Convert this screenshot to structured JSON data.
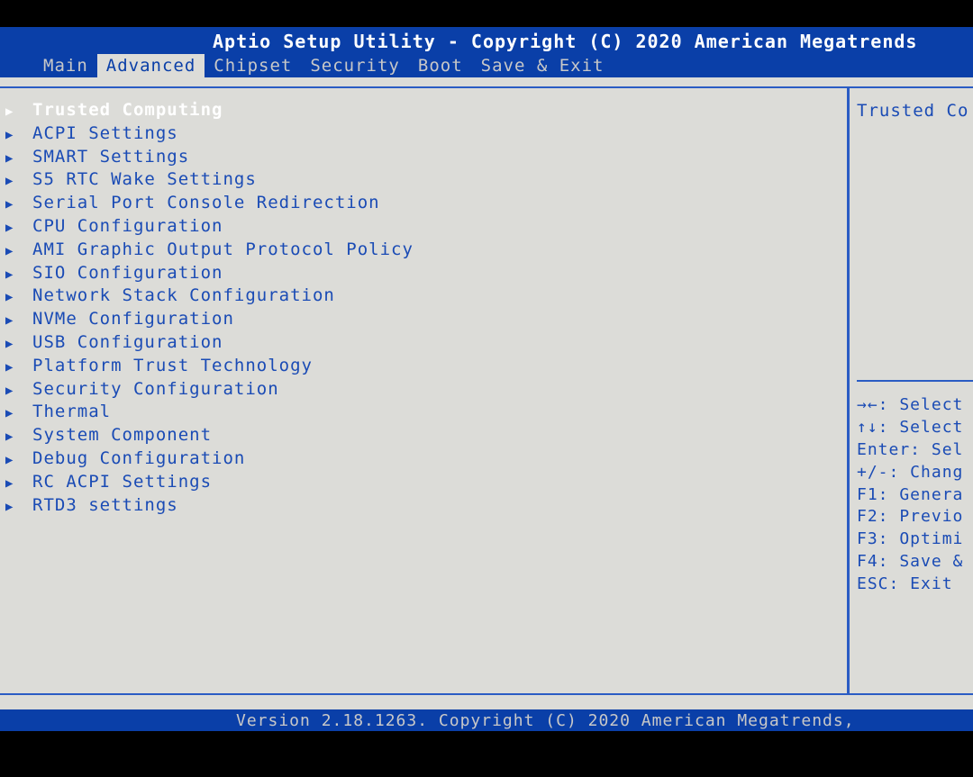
{
  "header": {
    "title": "Aptio Setup Utility - Copyright (C) 2020 American Megatrends"
  },
  "tabs": [
    {
      "label": "Main"
    },
    {
      "label": "Advanced"
    },
    {
      "label": "Chipset"
    },
    {
      "label": "Security"
    },
    {
      "label": "Boot"
    },
    {
      "label": "Save & Exit"
    }
  ],
  "active_tab": "Advanced",
  "menu": {
    "arrow_glyph": "▶",
    "items": [
      {
        "label": "Trusted Computing"
      },
      {
        "label": "ACPI Settings"
      },
      {
        "label": "SMART Settings"
      },
      {
        "label": "S5 RTC Wake Settings"
      },
      {
        "label": "Serial Port Console Redirection"
      },
      {
        "label": "CPU Configuration"
      },
      {
        "label": "AMI Graphic Output Protocol Policy"
      },
      {
        "label": "SIO Configuration"
      },
      {
        "label": "Network Stack Configuration"
      },
      {
        "label": "NVMe Configuration"
      },
      {
        "label": "USB Configuration"
      },
      {
        "label": "Platform Trust Technology"
      },
      {
        "label": "Security Configuration"
      },
      {
        "label": "Thermal"
      },
      {
        "label": "System Component"
      },
      {
        "label": "Debug Configuration"
      },
      {
        "label": "RC ACPI Settings"
      },
      {
        "label": "RTD3 settings"
      }
    ],
    "selected": "Trusted Computing"
  },
  "help": {
    "text": "Trusted Co"
  },
  "keys": [
    "→←: Select",
    "↑↓: Select",
    "Enter: Sel",
    "+/-: Chang",
    "F1: Genera",
    "F2: Previo",
    "F3: Optimi",
    "F4: Save &",
    "ESC: Exit"
  ],
  "footer": {
    "text": "Version 2.18.1263. Copyright (C) 2020 American Megatrends,"
  },
  "colors": {
    "header_bg": "#0a3fa8",
    "panel_bg": "#dcdcd8",
    "menu_text": "#1a4bb5",
    "selected_text": "#ffffff",
    "inactive_tab_text": "#c8c8c8"
  }
}
